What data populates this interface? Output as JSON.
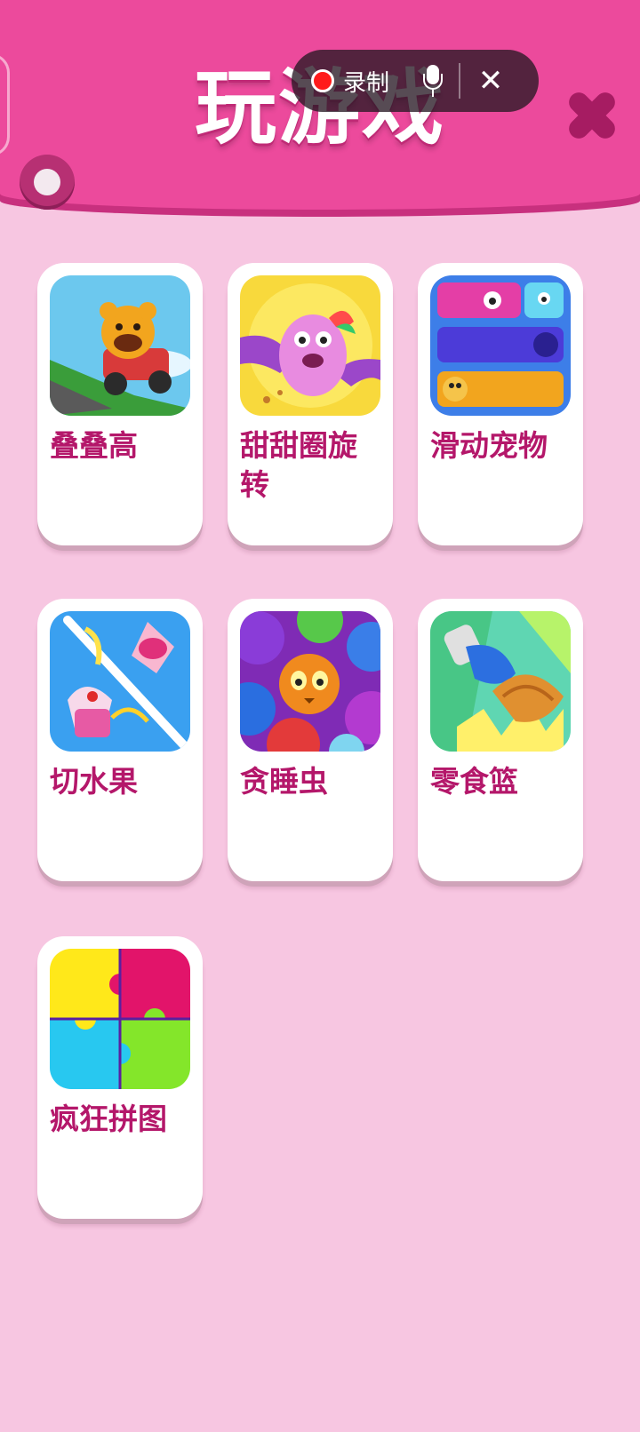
{
  "header": {
    "title": "玩游戏"
  },
  "recording_bar": {
    "record_label": "录制",
    "close_glyph": "✕"
  },
  "games": [
    {
      "label": "叠叠高",
      "icon": "go-kart-bear-icon"
    },
    {
      "label": "甜甜圈旋转",
      "icon": "donut-unicorn-icon"
    },
    {
      "label": "滑动宠物",
      "icon": "sliding-pets-icon"
    },
    {
      "label": "切水果",
      "icon": "cut-fruit-icon"
    },
    {
      "label": "贪睡虫",
      "icon": "sleepy-bugs-icon"
    },
    {
      "label": "零食篮",
      "icon": "snack-basket-icon"
    },
    {
      "label": "疯狂拼图",
      "icon": "jigsaw-puzzle-icon"
    }
  ],
  "colors": {
    "header": "#ec4a9c",
    "background": "#f7c6e1",
    "label": "#b4176a"
  }
}
